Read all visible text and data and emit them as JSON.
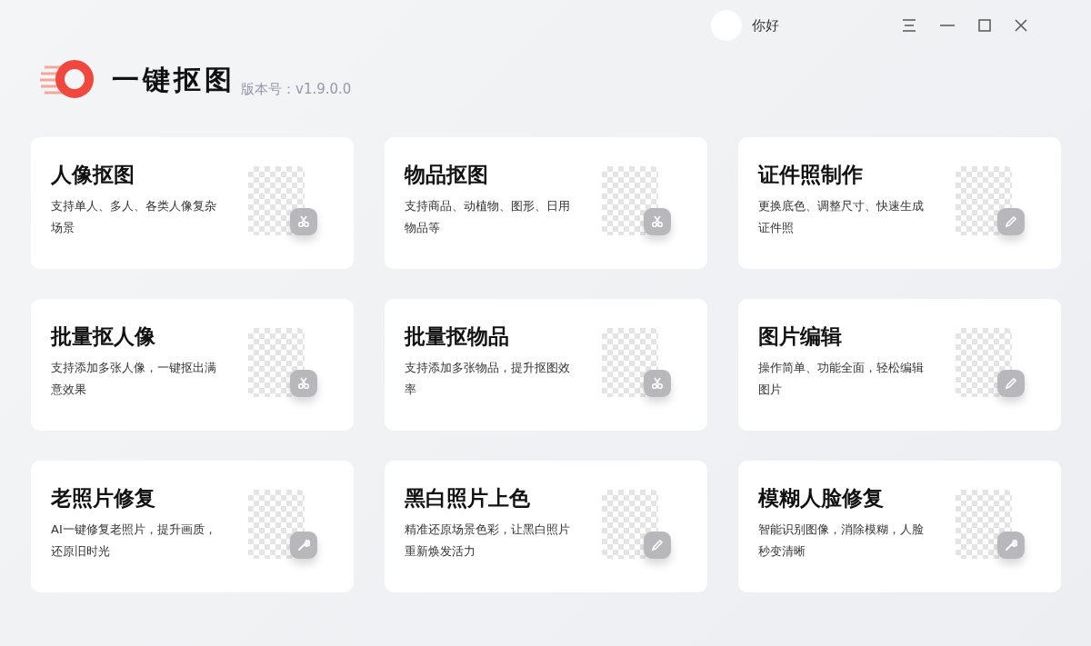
{
  "app": {
    "name": "一键抠图",
    "version": "版本号：v1.9.0.0"
  },
  "user": {
    "greeting": "你好"
  },
  "cards": [
    {
      "title": "人像抠图",
      "description": "支持单人、多人、各类人像复杂场景",
      "kind": "cut"
    },
    {
      "title": "物品抠图",
      "description": "支持商品、动植物、图形、日用物品等",
      "kind": "cut"
    },
    {
      "title": "证件照制作",
      "description": "更换底色、调整尺寸、快速生成证件照",
      "kind": "edit"
    },
    {
      "title": "批量抠人像",
      "description": "支持添加多张人像，一键抠出满意效果",
      "kind": "cut"
    },
    {
      "title": "批量抠物品",
      "description": "支持添加多张物品，提升抠图效率",
      "kind": "cut"
    },
    {
      "title": "图片编辑",
      "description": "操作简单、功能全面，轻松编辑图片",
      "kind": "edit"
    },
    {
      "title": "老照片修复",
      "description": "AI一键修复老照片，提升画质，还原旧时光",
      "kind": "repair"
    },
    {
      "title": "黑白照片上色",
      "description": "精准还原场景色彩，让黑白照片重新焕发活力",
      "kind": "edit"
    },
    {
      "title": "模糊人脸修复",
      "description": "智能识别图像，消除模糊，人脸秒变清晰",
      "kind": "repair"
    }
  ]
}
